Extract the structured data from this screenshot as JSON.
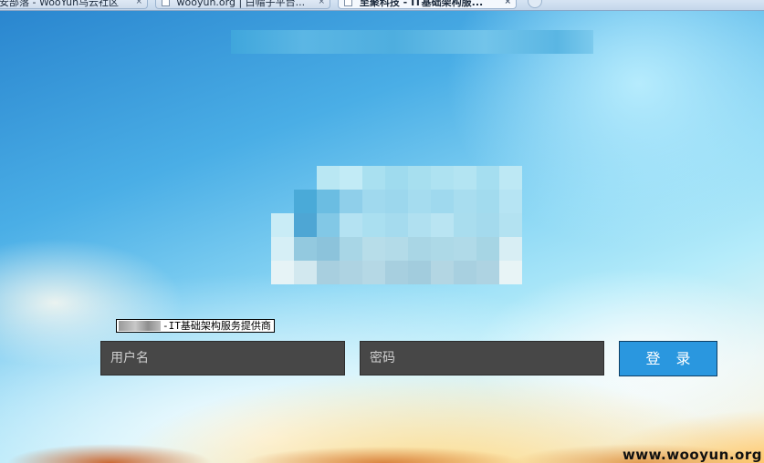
{
  "browser": {
    "tabs": [
      {
        "label": "安部落 - WooYun乌云社区",
        "active": false
      },
      {
        "label": "wooyun.org | 白帽子平台...",
        "active": false
      },
      {
        "label": "至聚科技 - IT基础架构服...",
        "active": true
      }
    ],
    "close_glyph": "×"
  },
  "page": {
    "subtitle": "-IT基础架构服务提供商",
    "username_placeholder": "用户名",
    "password_placeholder": "密码",
    "login_label": "登 录"
  },
  "watermark": "www.wooyun.org",
  "colors": {
    "field_bg": "#474747",
    "button_bg": "#2a97df"
  }
}
